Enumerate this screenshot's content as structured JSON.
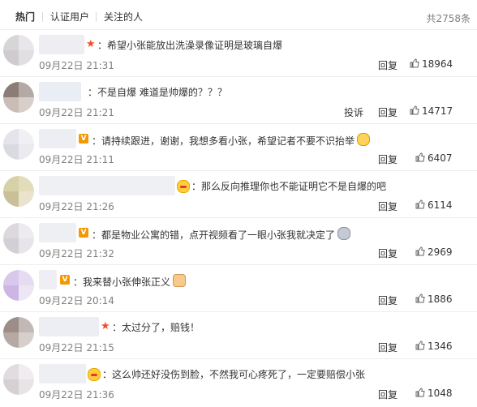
{
  "tabs": [
    "热门",
    "认证用户",
    "关注的人"
  ],
  "total": "共2758条",
  "reply_label": "回复",
  "report_label": "投诉",
  "comments": [
    {
      "text": "：希望小张能放出洗澡录像证明是玻璃自爆",
      "date": "09月22日 21:31",
      "likes": "18964",
      "badge": "star",
      "emoji": null
    },
    {
      "text": "：不是自爆 难道是帅爆的？？？",
      "date": "09月22日 21:21",
      "likes": "14717",
      "badge": null,
      "emoji": null
    },
    {
      "text": "：请持续跟进，谢谢，我想多看小张，希望记者不要不识抬举",
      "date": "09月22日 21:11",
      "likes": "6407",
      "badge": "v",
      "emoji": "face"
    },
    {
      "text": "：那么反向推理你也不能证明它不是自爆的吧",
      "date": "09月22日 21:26",
      "likes": "6114",
      "badge": null,
      "emoji": null
    },
    {
      "text": "：都是物业公寓的错，点开视频看了一眼小张我就决定了",
      "date": "09月22日 21:32",
      "likes": "2969",
      "badge": "v",
      "emoji": "gray"
    },
    {
      "text": "：我来替小张伸张正义",
      "date": "09月22日 20:14",
      "likes": "1886",
      "badge": "v",
      "emoji": "hand"
    },
    {
      "text": "：太过分了，赔钱！",
      "date": "09月22日 21:15",
      "likes": "1346",
      "badge": "star",
      "emoji": null
    },
    {
      "text": "：这么帅还好没伤到脸，不然我可心疼死了，一定要赔偿小张",
      "date": "09月22日 21:36",
      "likes": "1048",
      "badge": null,
      "emoji": null
    }
  ]
}
